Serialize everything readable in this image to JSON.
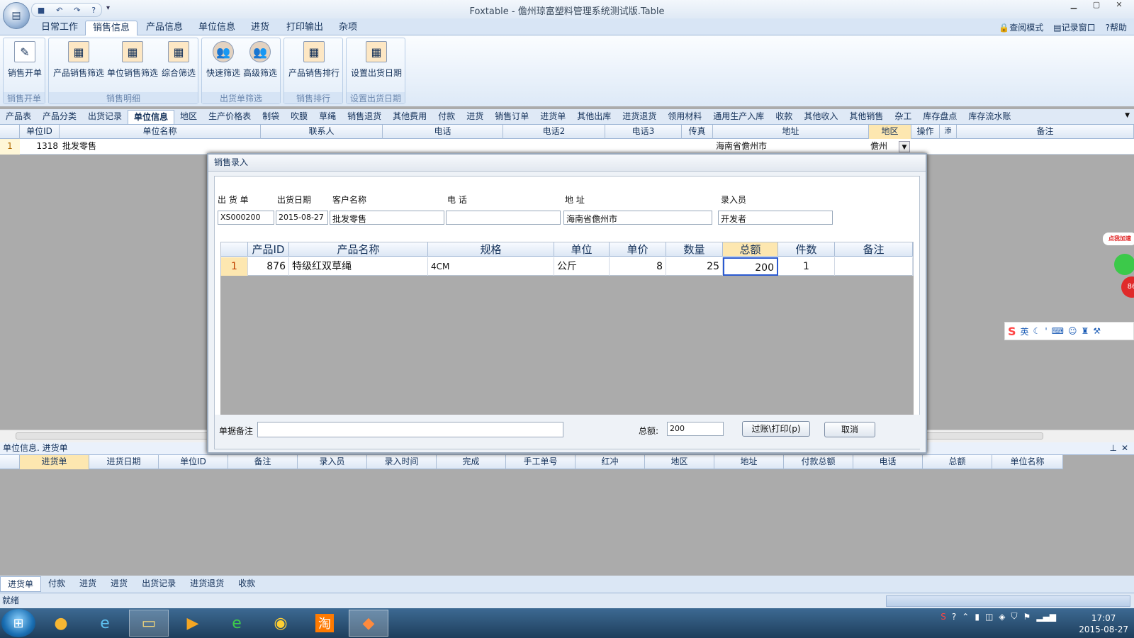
{
  "window": {
    "title": "Foxtable - 儋州琼富塑料管理系统测试版.Table"
  },
  "ribbon_tabs": [
    "日常工作",
    "销售信息",
    "产品信息",
    "单位信息",
    "进货",
    "打印输出",
    "杂项"
  ],
  "ribbon_right": [
    "查阅模式",
    "记录窗口",
    "帮助"
  ],
  "ribbon_groups": [
    {
      "label": "销售开单",
      "buttons": [
        "销售开单"
      ]
    },
    {
      "label": "销售明细",
      "buttons": [
        "产品销售筛选",
        "单位销售筛选",
        "综合筛选"
      ]
    },
    {
      "label": "出货单筛选",
      "buttons": [
        "快速筛选",
        "高级筛选"
      ]
    },
    {
      "label": "销售排行",
      "buttons": [
        "产品销售排行"
      ]
    },
    {
      "label": "设置出货日期",
      "buttons": [
        "设置出货日期"
      ]
    }
  ],
  "sheet_tabs": [
    "产品表",
    "产品分类",
    "出货记录",
    "单位信息",
    "地区",
    "生产价格表",
    "制袋",
    "吹膜",
    "草绳",
    "销售退货",
    "其他费用",
    "付款",
    "进货",
    "销售订单",
    "进货单",
    "其他出库",
    "进货退货",
    "领用材料",
    "通用生产入库",
    "收款",
    "其他收入",
    "其他销售",
    "杂工",
    "库存盘点",
    "库存流水账"
  ],
  "grid1": {
    "headers": [
      "单位ID",
      "单位名称",
      "联系人",
      "电话",
      "电话2",
      "电话3",
      "传真",
      "地址",
      "地区",
      "操作",
      "添",
      "备注"
    ],
    "row": {
      "num": "1",
      "id": "1318",
      "name": "批发零售",
      "address": "海南省儋州市",
      "region": "儋州"
    }
  },
  "panel2": {
    "title": "单位信息. 进货单",
    "headers": [
      "进货单",
      "进货日期",
      "单位ID",
      "备注",
      "录入员",
      "录入时间",
      "完成",
      "手工单号",
      "红冲",
      "地区",
      "地址",
      "付款总额",
      "电话",
      "总额",
      "单位名称"
    ]
  },
  "bottom_tabs": [
    "进货单",
    "付款",
    "进货",
    "进货",
    "出货记录",
    "进货退货",
    "收款"
  ],
  "status": {
    "text": "就绪"
  },
  "dialog": {
    "title": "销售录入",
    "labels": [
      "出 货 单",
      "出货日期",
      "客户名称",
      "电  话",
      "地  址",
      "录入员"
    ],
    "values": [
      "XS000200",
      "2015-08-27",
      "批发零售",
      "",
      "海南省儋州市",
      "开发者"
    ],
    "grid_headers": [
      "产品ID",
      "产品名称",
      "规格",
      "单位",
      "单价",
      "数量",
      "总额",
      "件数",
      "备注"
    ],
    "grid_row": {
      "num": "1",
      "pid": "876",
      "name": "特级红双草绳",
      "spec": "4CM",
      "unit": "公斤",
      "price": "8",
      "qty": "25",
      "total": "200",
      "pieces": "1",
      "note": ""
    },
    "remark_label": "单据备注",
    "total_label": "总额:",
    "total_value": "200",
    "post_print": "过账\\打印(p)",
    "cancel": "取消"
  },
  "taskbar": {
    "time": "17:07",
    "date": "2015-08-27"
  },
  "side_widget": {
    "label": "点我加速",
    "value": "86"
  },
  "ime": {
    "lang": "英"
  }
}
